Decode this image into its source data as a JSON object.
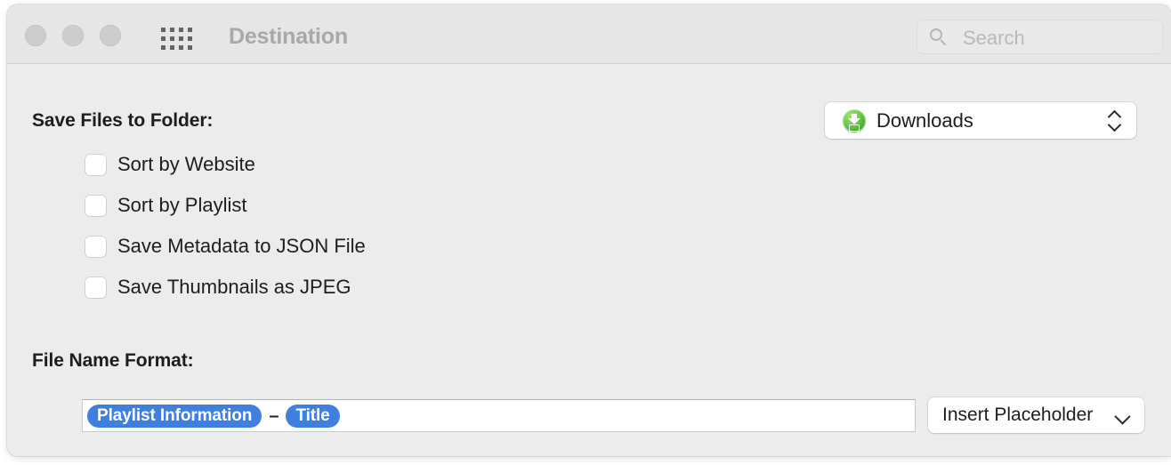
{
  "window": {
    "title": "Destination",
    "traffic_lights": [
      "close",
      "minimize",
      "zoom"
    ],
    "show_all_icon": "grid-icon",
    "colors": {
      "toolbar_bg": "#e6e6e6",
      "content_bg": "#ececec",
      "token_blue": "#3f7fe0",
      "title_gray": "#a8a8a8",
      "downloads_green": "#6ec94b"
    }
  },
  "search": {
    "placeholder": "Search",
    "value": "",
    "icon": "search-icon"
  },
  "destination": {
    "folder_label": "Save Files to Folder:",
    "folder_popup": {
      "value": "Downloads",
      "icon": "downloads-folder-icon",
      "indicator": "chevron-up-down-icon"
    },
    "checkboxes": [
      {
        "label": "Sort by Website",
        "checked": false
      },
      {
        "label": "Sort by Playlist",
        "checked": false
      },
      {
        "label": "Save Metadata to JSON File",
        "checked": false
      },
      {
        "label": "Save Thumbnails as JPEG",
        "checked": false
      }
    ]
  },
  "file_name_format": {
    "label": "File Name Format:",
    "tokens": [
      {
        "text": "Playlist Information",
        "type": "token"
      },
      {
        "text": "–",
        "type": "separator"
      },
      {
        "text": "Title",
        "type": "token"
      }
    ],
    "insert_button": {
      "label": "Insert Placeholder",
      "indicator": "chevron-down-icon"
    }
  }
}
